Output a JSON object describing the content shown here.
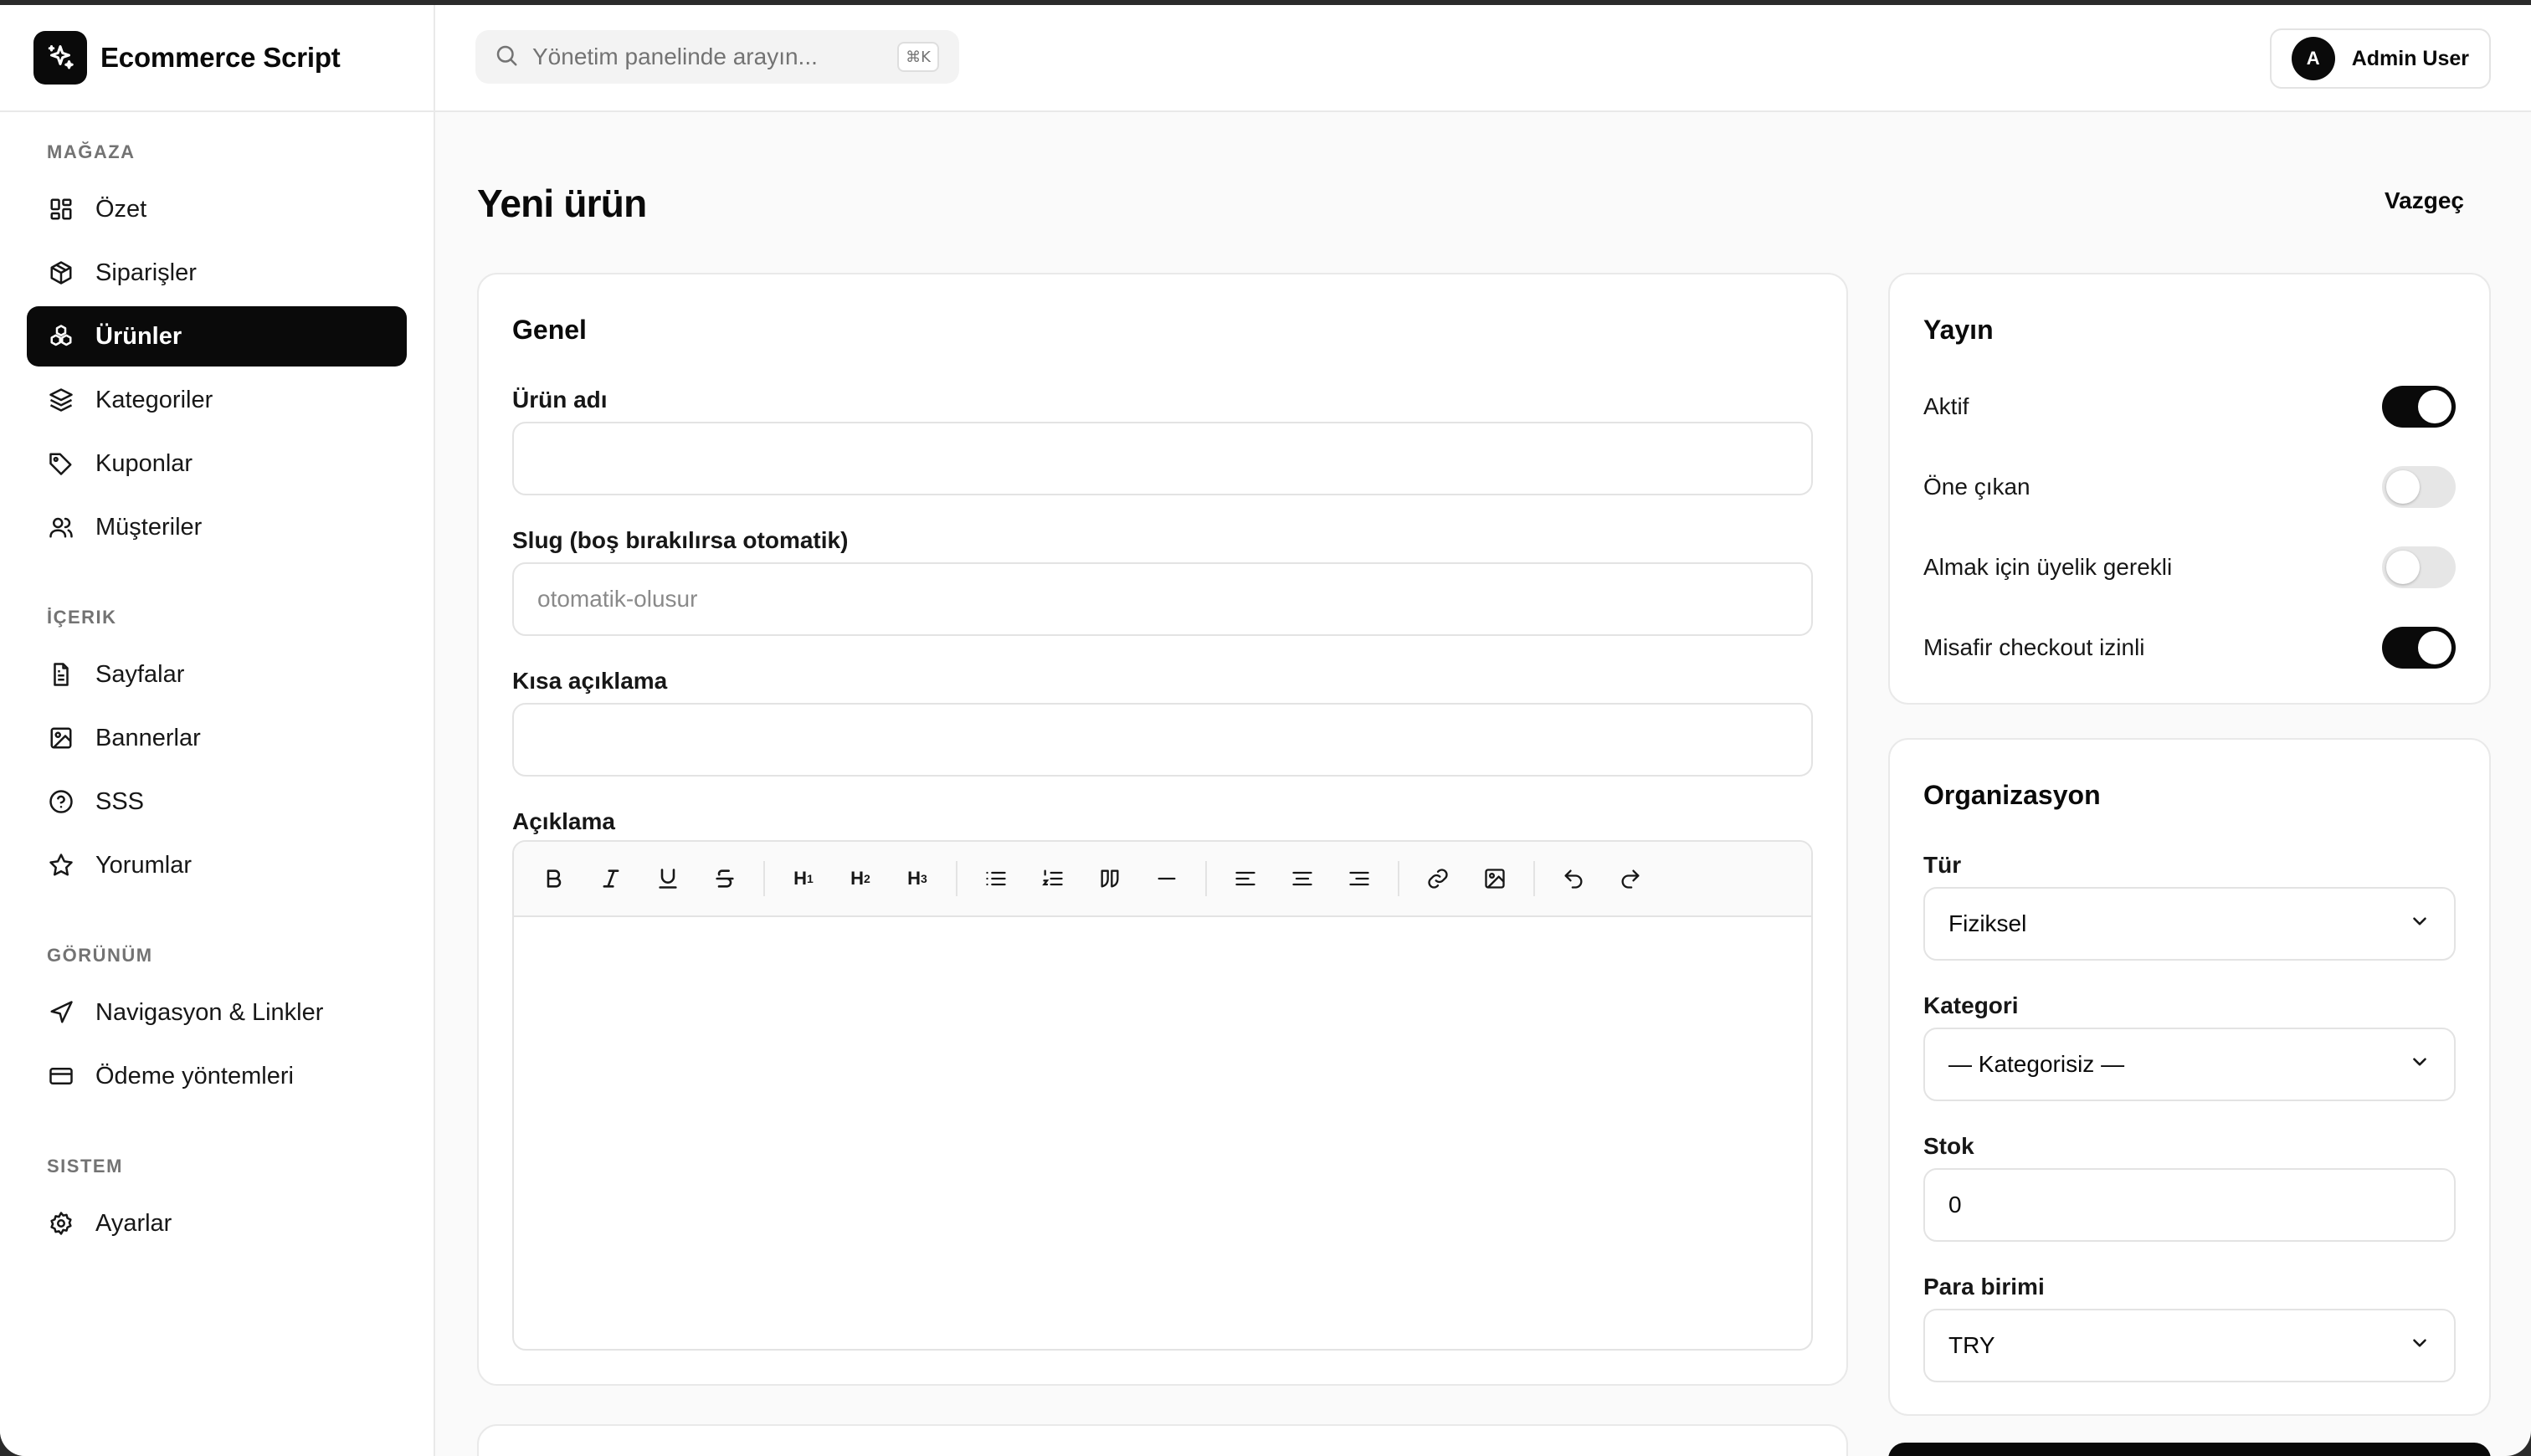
{
  "brand": {
    "name": "Ecommerce Script"
  },
  "sidebar": {
    "sections": [
      {
        "title": "MAĞAZA",
        "items": [
          "Özet",
          "Siparişler",
          "Ürünler",
          "Kategoriler",
          "Kuponlar",
          "Müşteriler"
        ]
      },
      {
        "title": "İÇERIK",
        "items": [
          "Sayfalar",
          "Bannerlar",
          "SSS",
          "Yorumlar"
        ]
      },
      {
        "title": "GÖRÜNÜM",
        "items": [
          "Navigasyon & Linkler",
          "Ödeme yöntemleri"
        ]
      },
      {
        "title": "SISTEM",
        "items": [
          "Ayarlar"
        ]
      }
    ],
    "active_item": "Ürünler"
  },
  "topbar": {
    "search_placeholder": "Yönetim panelinde arayın...",
    "shortcut": "⌘K",
    "user_initial": "A",
    "user_name": "Admin User"
  },
  "page": {
    "title": "Yeni ürün",
    "cancel_label": "Vazgeç"
  },
  "general": {
    "title": "Genel",
    "name_label": "Ürün adı",
    "name_value": "",
    "slug_label": "Slug (boş bırakılırsa otomatik)",
    "slug_placeholder": "otomatik-olusur",
    "short_desc_label": "Kısa açıklama",
    "short_desc_value": "",
    "desc_label": "Açıklama",
    "toolbar": {
      "h1": "H",
      "h1_sub": "1",
      "h2": "H",
      "h2_sub": "2",
      "h3": "H",
      "h3_sub": "3"
    }
  },
  "publish": {
    "title": "Yayın",
    "toggles": [
      {
        "label": "Aktif",
        "on": true
      },
      {
        "label": "Öne çıkan",
        "on": false
      },
      {
        "label": "Almak için üyelik gerekli",
        "on": false
      },
      {
        "label": "Misafir checkout izinli",
        "on": true
      }
    ]
  },
  "organization": {
    "title": "Organizasyon",
    "type_label": "Tür",
    "type_value": "Fiziksel",
    "category_label": "Kategori",
    "category_value": "— Kategorisiz —",
    "stock_label": "Stok",
    "stock_value": "0",
    "currency_label": "Para birimi",
    "currency_value": "TRY"
  },
  "colors": {
    "accent": "#0a0a0a",
    "border": "#e3e3e3",
    "background": "#fafafa"
  }
}
